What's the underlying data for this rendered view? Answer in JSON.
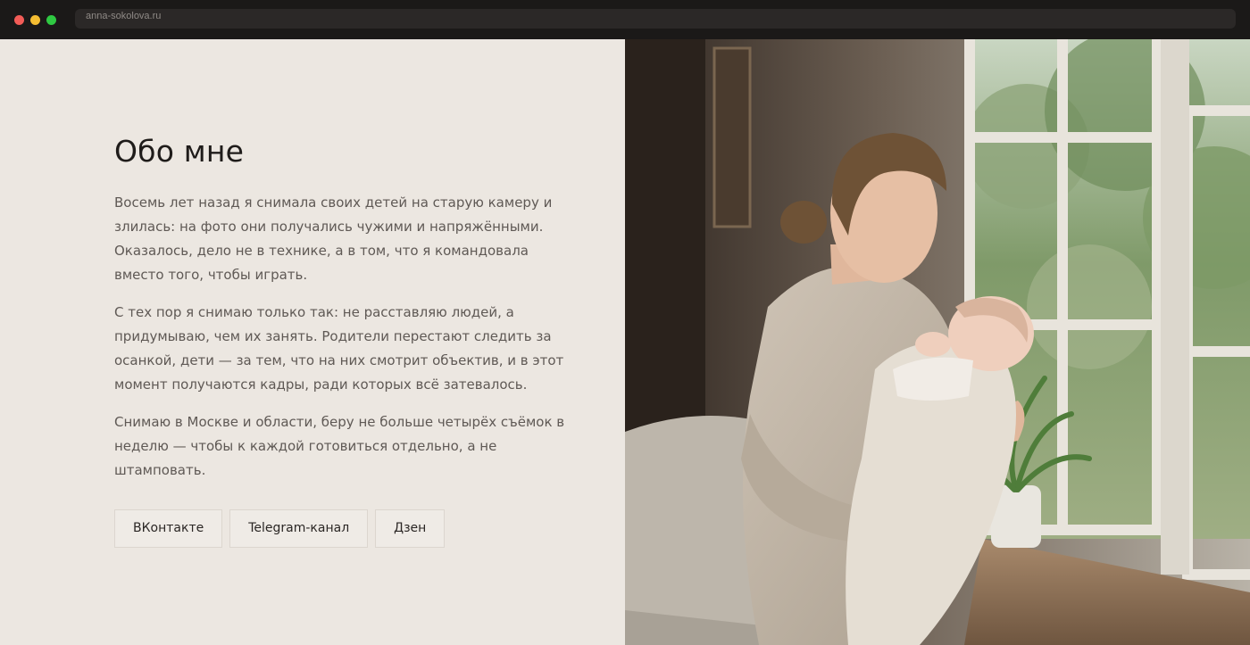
{
  "browser": {
    "url": "anna-sokolova.ru"
  },
  "about": {
    "title": "Обо мне",
    "paragraphs": [
      "Восемь лет назад я снимала своих детей на старую камеру и злилась: на фото они получались чужими и напряжёнными. Оказалось, дело не в технике, а в том, что я командовала вместо того, чтобы играть.",
      "С тех пор я снимаю только так: не расставляю людей, а придумываю, чем их занять. Родители перестают следить за осанкой, дети — за тем, что на них смотрит объектив, и в этот момент получаются кадры, ради которых всё затевалось.",
      "Снимаю в Москве и области, беру не больше четырёх съёмок в неделю — чтобы к каждой готовиться отдельно, а не штамповать."
    ],
    "links": [
      "ВКонтакте",
      "Telegram-канал",
      "Дзен"
    ]
  },
  "colors": {
    "panel_bg": "#ece7e1",
    "title": "#1f1c1a",
    "body_text": "#5f5955",
    "button_border": "#dcd6cf"
  }
}
